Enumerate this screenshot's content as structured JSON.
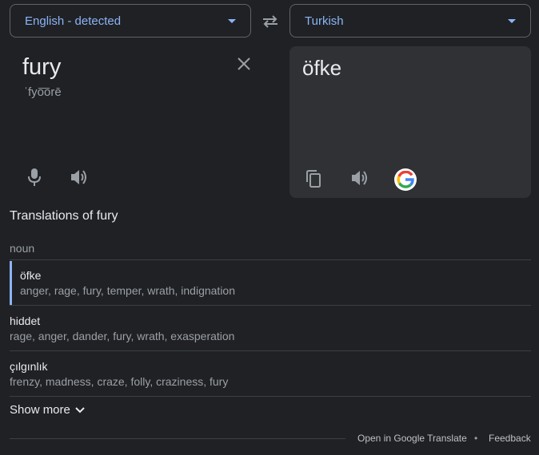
{
  "source_language": {
    "label": "English - detected"
  },
  "target_language": {
    "label": "Turkish"
  },
  "source": {
    "text": "fury",
    "phonetic": "ˈfyo͞orē"
  },
  "target": {
    "text": "öfke"
  },
  "translations": {
    "heading": "Translations of fury",
    "part_of_speech": "noun",
    "entries": [
      {
        "word": "öfke",
        "synonyms": "anger, rage, fury, temper, wrath, indignation",
        "selected": true
      },
      {
        "word": "hiddet",
        "synonyms": "rage, anger, dander, fury, wrath, exasperation",
        "selected": false
      },
      {
        "word": "çılgınlık",
        "synonyms": "frenzy, madness, craze, folly, craziness, fury",
        "selected": false
      }
    ],
    "show_more": "Show more"
  },
  "footer": {
    "open_link": "Open in Google Translate",
    "separator": "•",
    "feedback": "Feedback"
  },
  "icons": {
    "swap": "swap-icon",
    "clear": "close-icon",
    "mic": "mic-icon",
    "speak": "speaker-icon",
    "copy": "copy-icon",
    "google": "google-logo-icon",
    "chevron": "chevron-down-icon"
  },
  "colors": {
    "background": "#202124",
    "panel": "#303134",
    "accent": "#8ab4f8",
    "text": "#e8eaed",
    "muted": "#9aa0a6",
    "divider": "#3c4043"
  }
}
